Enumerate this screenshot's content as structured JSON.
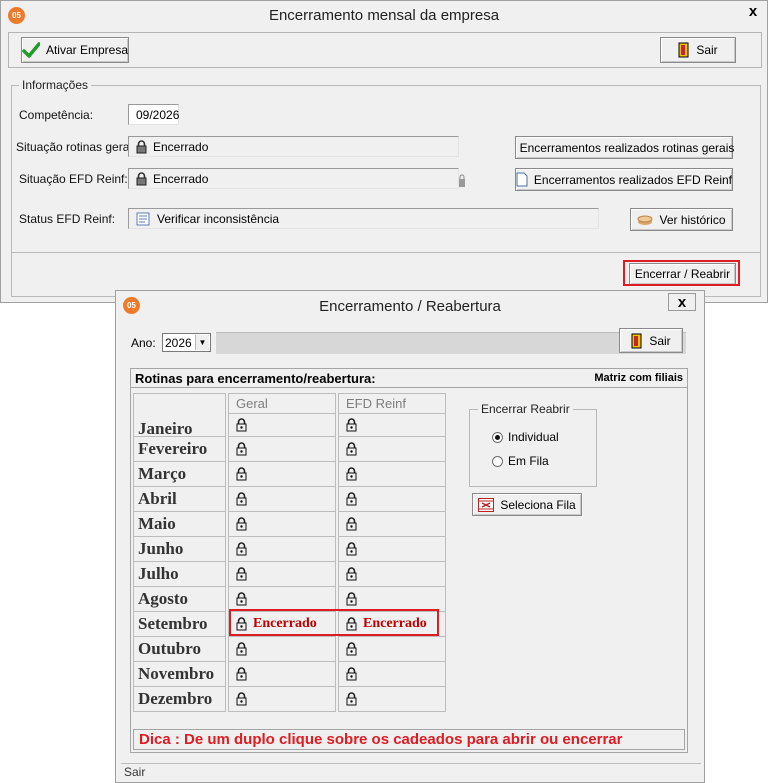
{
  "main_window": {
    "title": "Encerramento mensal da empresa",
    "app_icon_text": "05",
    "close_glyph": "x",
    "toolbar": {
      "ativar_label": "Ativar Empresa",
      "sair_label": "Sair"
    },
    "info": {
      "group_title": "Informações",
      "competencia_label": "Competência:",
      "competencia_value": "09/2026",
      "situacao_gerais_label": "Situação rotinas gerais:",
      "situacao_gerais_value": "Encerrado",
      "situacao_reinf_label": "Situação EFD Reinf:",
      "situacao_reinf_value": "Encerrado",
      "status_reinf_label": "Status EFD Reinf:",
      "status_reinf_value": "Verificar inconsistência",
      "btn_encerramentos_gerais": "Encerramentos realizados rotinas gerais",
      "btn_encerramentos_reinf": "Encerramentos realizados EFD Reinf",
      "btn_ver_historico": "Ver histórico",
      "btn_encerrar_reabrir": "Encerrar / Reabrir"
    }
  },
  "dialog": {
    "title": "Encerramento / Reabertura",
    "app_icon_text": "05",
    "close_glyph": "x",
    "ano_label": "Ano:",
    "ano_value": "2026",
    "sair_label": "Sair",
    "panel_title": "Rotinas para encerramento/reabertura:",
    "panel_subtitle": "Matriz com filiais",
    "col_geral": "Geral",
    "col_efd": "EFD Reinf",
    "months": [
      "Janeiro",
      "Fevereiro",
      "Março",
      "Abril",
      "Maio",
      "Junho",
      "Julho",
      "Agosto",
      "Setembro",
      "Outubro",
      "Novembro",
      "Dezembro"
    ],
    "geral_status": [
      "",
      "",
      "",
      "",
      "",
      "",
      "",
      "",
      "Encerrado",
      "",
      "",
      ""
    ],
    "efd_status": [
      "",
      "",
      "",
      "",
      "",
      "",
      "",
      "",
      "Encerrado",
      "",
      "",
      ""
    ],
    "radio_group_title": "Encerrar Reabrir",
    "radio_individual": "Individual",
    "radio_em_fila": "Em Fila",
    "radio_selected": "Individual",
    "btn_seleciona_fila": "Seleciona Fila",
    "dica": "Dica : De um duplo clique sobre os cadeados para  abrir ou encerrar",
    "status_bar": "Sair"
  },
  "colors": {
    "highlight_red": "#e01b22",
    "status_red": "#c00000",
    "window_bg": "#f0f0f0"
  }
}
